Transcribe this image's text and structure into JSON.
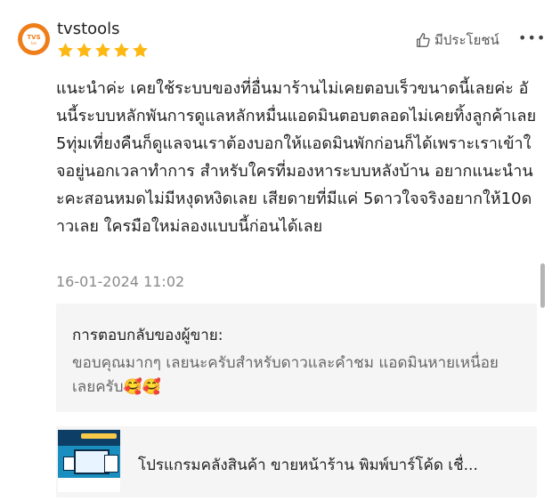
{
  "reviewer": {
    "name": "tvstools",
    "avatar_text": "TVS",
    "avatar_subtext": "tvs",
    "rating": 5
  },
  "actions": {
    "helpful_label": "มีประโยชน์",
    "more_label": "•••"
  },
  "review": {
    "text": "แนะนำค่ะ เคยใช้ระบบของที่อื่นมาร้านไม่เคยตอบเร็วขนาดนี้เลยค่ะ อันนี้ระบบหลักพันการดูแลหลักหมื่นแอดมินตอบตลอดไม่เคยทิ้งลูกค้าเลย 5ทุ่มเที่ยงคืนก็ดูแลจนเราต้องบอกให้แอดมินพักก่อนก็ได้เพราะเราเข้าใจอยู่นอกเวลาทำการ สำหรับใครที่มองหาระบบหลังบ้าน อยากแนะนำนะคะสอนหมดไม่มีหงุดหงิดเลย เสียดายที่มีแค่ 5ดาวใจจริงอยากให้10ดาวเลย ใครมือใหม่ลองแบบนี้ก่อนได้เลย",
    "date": "16-01-2024 11:02"
  },
  "seller_reply": {
    "title": "การตอบกลับของผู้ขาย:",
    "text": "ขอบคุณมากๆ เลยนะครับสำหรับดาวและคำชม แอดมินหายเหนื่อยเลยครับ",
    "emoji": "🥰🥰"
  },
  "product": {
    "name": "โปรแกรมคลังสินค้า ขายหน้าร้าน พิมพ์บาร์โค้ด เชื่...",
    "thumb_icon": "product-thumbnail"
  },
  "colors": {
    "star": "#fdb813",
    "brand": "#ef7d1a"
  }
}
